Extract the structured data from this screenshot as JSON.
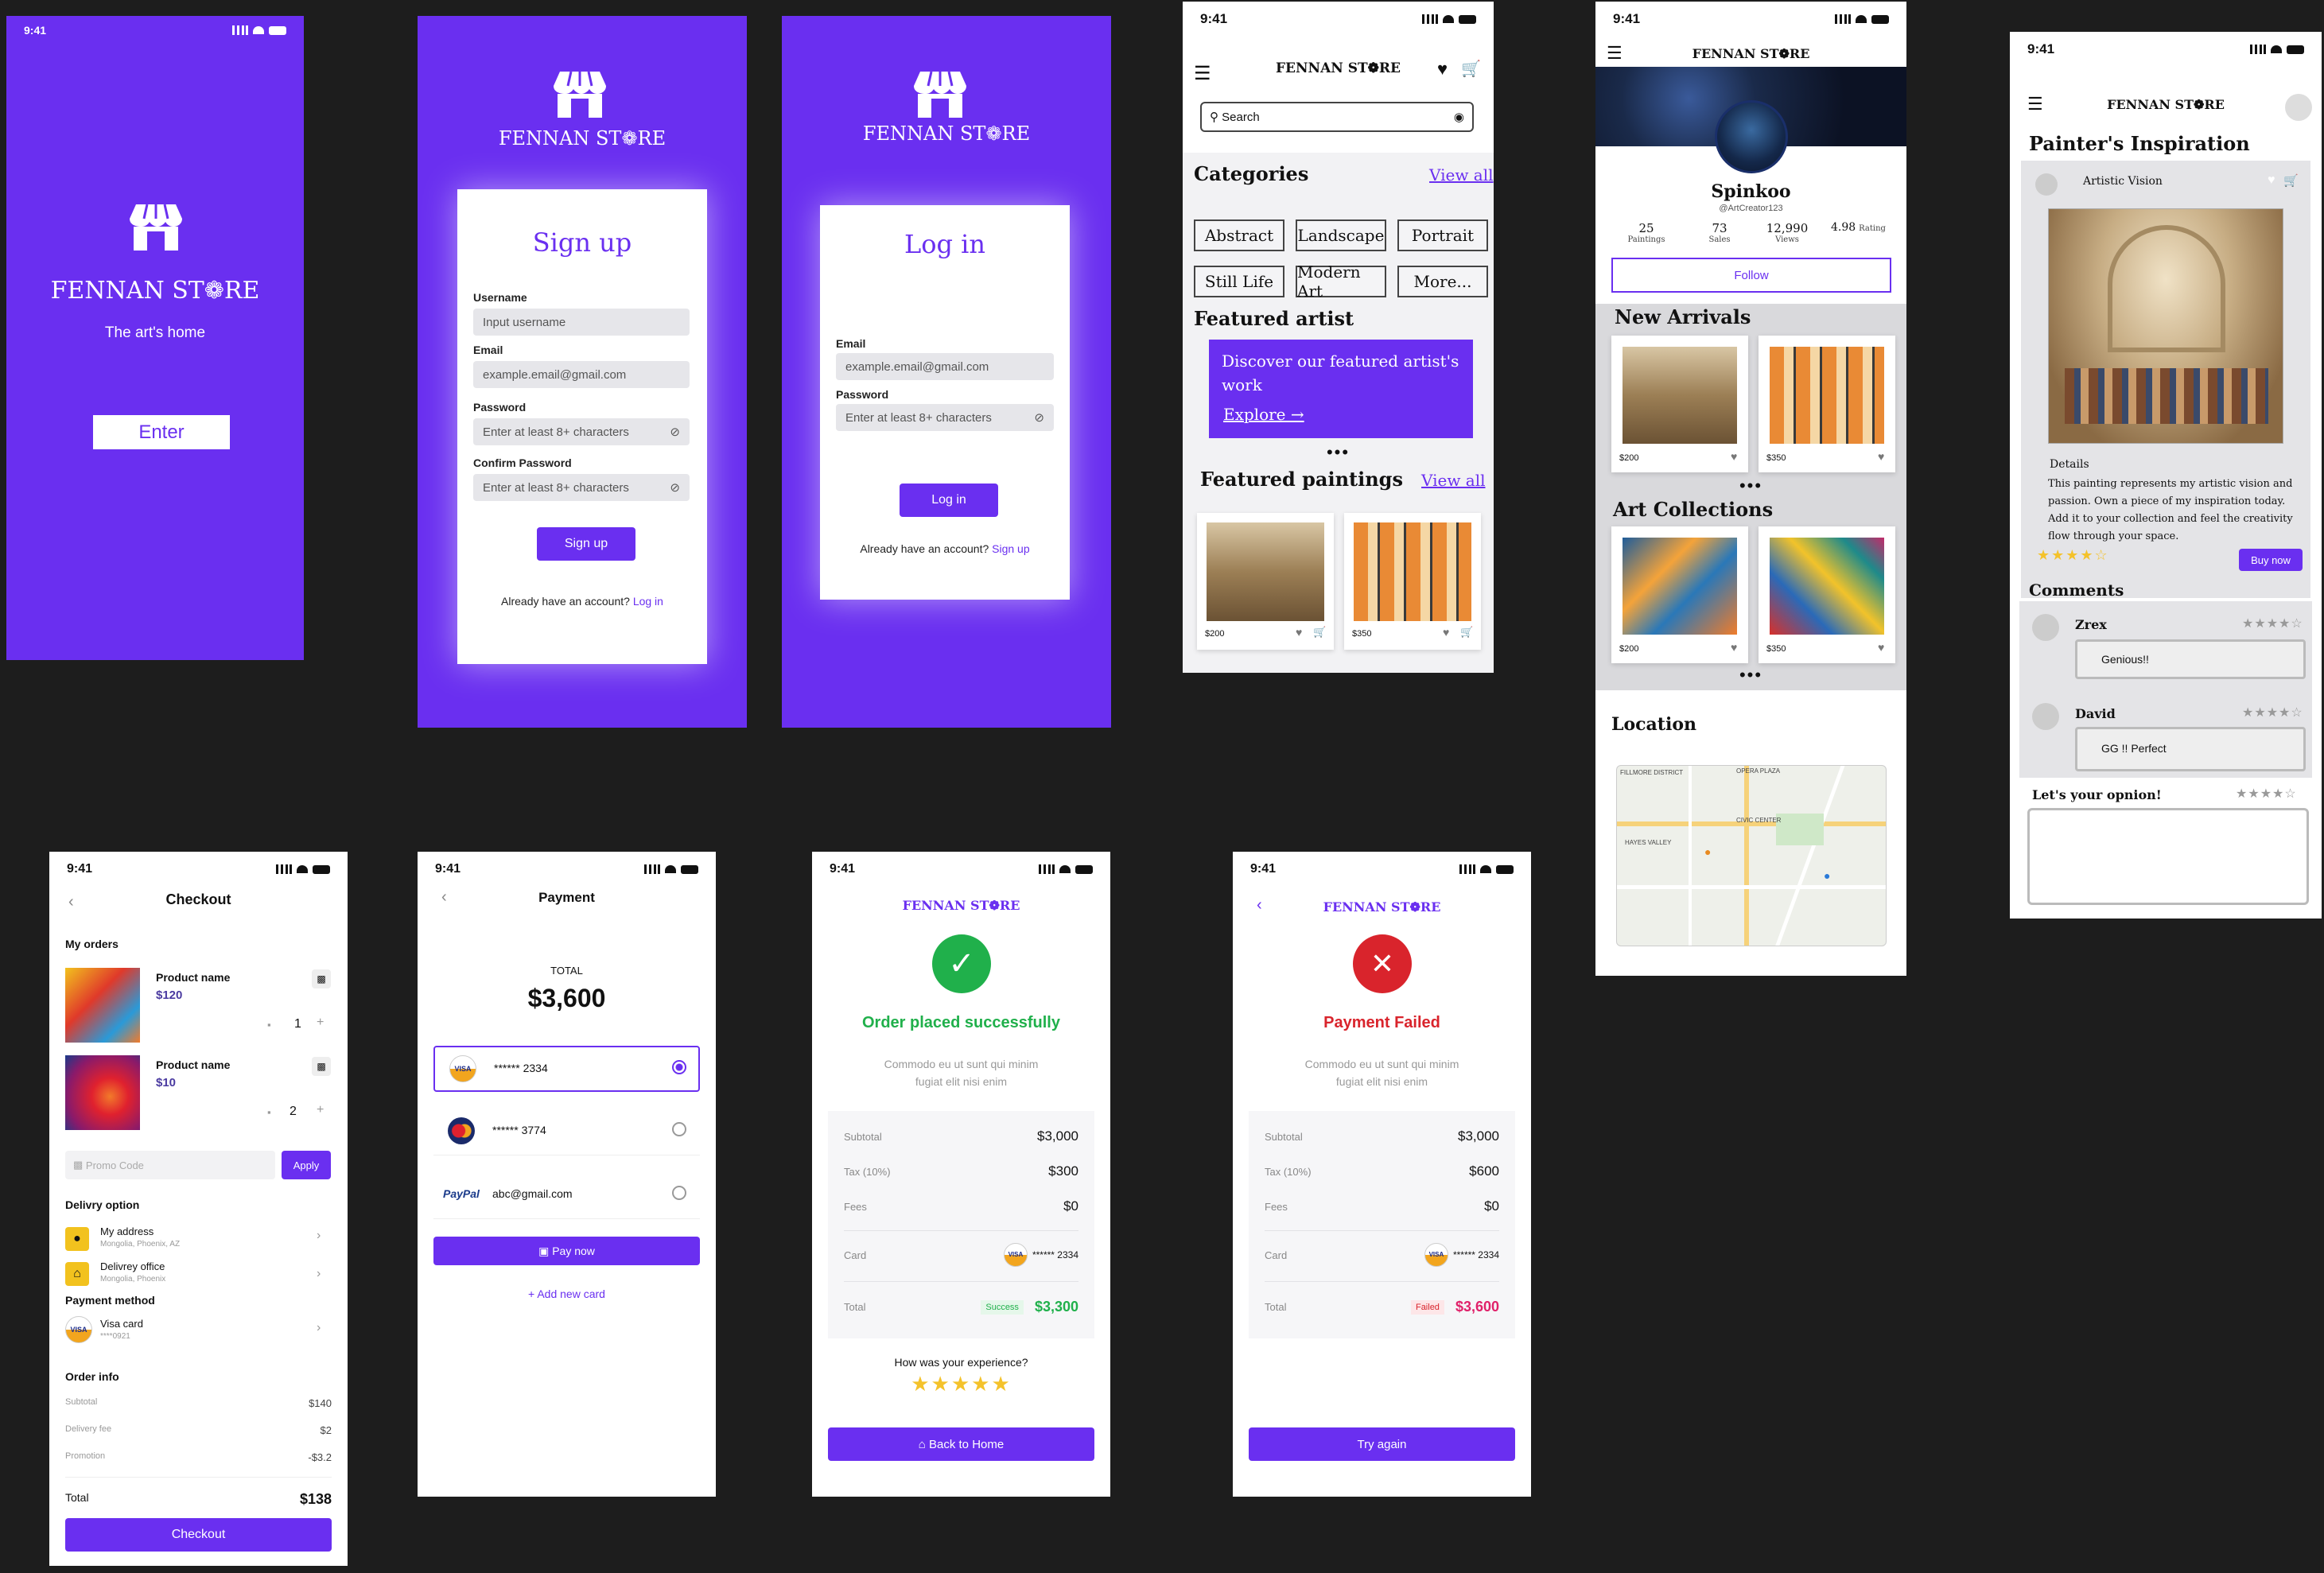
{
  "time": "9:41",
  "brand": "FENNAN ST❁RE",
  "splash": {
    "tagline": "The art's home",
    "enter": "Enter"
  },
  "signup": {
    "title": "Sign up",
    "username_label": "Username",
    "username_ph": "Input username",
    "email_label": "Email",
    "email_ph": "example.email@gmail.com",
    "password_label": "Password",
    "password_ph": "Enter at least 8+ characters",
    "confirm_label": "Confirm Password",
    "confirm_ph": "Enter at least 8+ characters",
    "button": "Sign up",
    "footer": "Already have an account?",
    "footer_link": "Log in"
  },
  "login": {
    "title": "Log in",
    "email_label": "Email",
    "email_ph": "example.email@gmail.com",
    "password_label": "Password",
    "password_ph": "Enter at least 8+ characters",
    "button": "Log in",
    "footer": "Already have an account?",
    "footer_link": "Sign up"
  },
  "home": {
    "search": "Search",
    "categories_title": "Categories",
    "view_all": "View all",
    "categories": [
      "Abstract",
      "Landscape",
      "Portrait",
      "Still Life",
      "Modern Art",
      "More..."
    ],
    "featured_artist": "Featured artist",
    "featured_text": "Discover our featured artist's work",
    "explore": "Explore →",
    "featured_paintings": "Featured paintings",
    "prices": [
      "$200",
      "$350"
    ]
  },
  "profile": {
    "name": "Spinkoo",
    "handle": "@ArtCreator123",
    "stats": [
      {
        "v": "25",
        "l": "Paintings"
      },
      {
        "v": "73",
        "l": "Sales"
      },
      {
        "v": "12,990",
        "l": "Views"
      },
      {
        "v": "4.98",
        "l": "Rating"
      }
    ],
    "follow": "Follow",
    "new_arrivals": "New Arrivals",
    "art_collections": "Art Collections",
    "prices": [
      "$200",
      "$350",
      "$200",
      "$350"
    ],
    "location": "Location",
    "map_labels": [
      "FILLMORE DISTRICT",
      "OPERA PLAZA",
      "CIVIC CENTER",
      "HAYES VALLEY"
    ]
  },
  "detail": {
    "title": "Painter's Inspiration",
    "artist": "Artistic Vision",
    "details_label": "Details",
    "description": "This painting represents my artistic vision and passion. Own a piece of my inspiration today. Add it to your collection and feel the creativity flow through your space.",
    "buy": "Buy now",
    "comments": "Comments",
    "c1_name": "Zrex",
    "c1_text": "Genious!!",
    "c2_name": "David",
    "c2_text": "GG !! Perfect",
    "opinion": "Let's your opnion!"
  },
  "checkout": {
    "title": "Checkout",
    "my_orders": "My orders",
    "p1_name": "Product name",
    "p1_price": "$120",
    "p1_qty": "1",
    "p2_name": "Product name",
    "p2_price": "$10",
    "p2_qty": "2",
    "promo_ph": "Promo Code",
    "apply": "Apply",
    "delivery": "Delivry option",
    "addr": "My address",
    "addr_sub": "Mongolia, Phoenix, AZ",
    "office": "Delivrey office",
    "office_sub": "Mongolia, Phoenix",
    "payment": "Payment method",
    "visa": "Visa card",
    "visa_sub": "****0921",
    "order_info": "Order info",
    "subtotal_l": "Subtotal",
    "subtotal": "$140",
    "delivery_l": "Delivery fee",
    "delivery_v": "$2",
    "promo_l": "Promotion",
    "promo_v": "-$3.2",
    "total_l": "Total",
    "total": "$138",
    "button": "Checkout"
  },
  "payment": {
    "title": "Payment",
    "total_l": "TOTAL",
    "total": "$3,600",
    "card1": "****** 2334",
    "card2": "****** 3774",
    "paypal": "abc@gmail.com",
    "pay": "Pay now",
    "add": "Add new card",
    "visa": "VISA",
    "pp": "PayPal"
  },
  "success": {
    "title": "Order placed successfully",
    "sub": "Commodo eu ut sunt qui minim fugiat elit nisi enim",
    "subtotal_l": "Subtotal",
    "subtotal": "$3,000",
    "tax_l": "Tax (10%)",
    "tax": "$300",
    "fees_l": "Fees",
    "fees": "$0",
    "card_l": "Card",
    "card": "****** 2334",
    "total_l": "Total",
    "badge": "Success",
    "total": "$3,300",
    "exp": "How was your experience?",
    "button": "Back to Home"
  },
  "failed": {
    "title": "Payment Failed",
    "sub": "Commodo eu ut sunt qui minim fugiat elit nisi enim",
    "subtotal_l": "Subtotal",
    "subtotal": "$3,000",
    "tax_l": "Tax (10%)",
    "tax": "$600",
    "fees_l": "Fees",
    "fees": "$0",
    "card_l": "Card",
    "card": "****** 2334",
    "total_l": "Total",
    "badge": "Failed",
    "total": "$3,600",
    "button": "Try again"
  },
  "colors": {
    "primary": "#6a2ff0",
    "success": "#20b04b",
    "danger": "#d9242c",
    "star": "#f4c22b"
  }
}
